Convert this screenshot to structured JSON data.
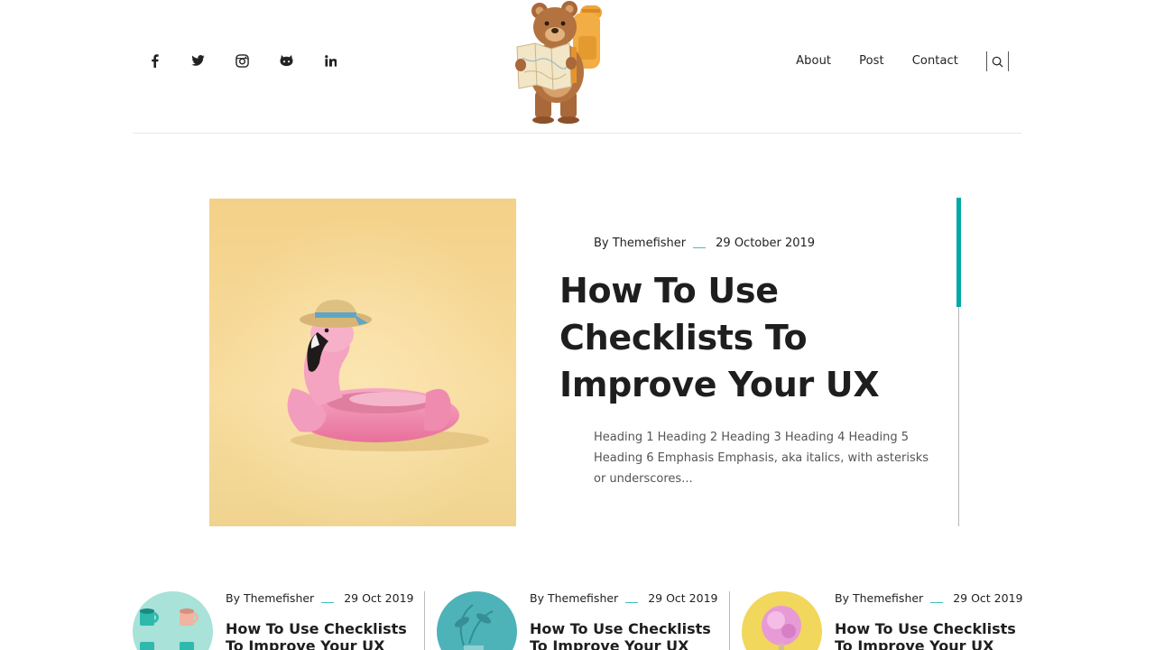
{
  "social": [
    {
      "icon": "facebook-icon"
    },
    {
      "icon": "twitter-icon"
    },
    {
      "icon": "instagram-icon"
    },
    {
      "icon": "github-icon"
    },
    {
      "icon": "linkedin-icon"
    }
  ],
  "nav": {
    "about": "About",
    "post": "Post",
    "contact": "Contact",
    "search_icon": "search-icon"
  },
  "featured": {
    "author": "By Themefisher",
    "date": "29 October 2019",
    "title": "How To Use Checklists To Improve Your UX",
    "excerpt": "Heading 1 Heading 2 Heading 3 Heading 4 Heading 5 Heading 6 Emphasis Emphasis, aka italics, with asterisks or underscores..."
  },
  "cards": [
    {
      "author": "By Themefisher",
      "date": "29 Oct 2019",
      "title": "How To Use Checklists To Improve Your UX"
    },
    {
      "author": "By Themefisher",
      "date": "29 Oct 2019",
      "title": "How To Use Checklists To Improve Your UX"
    },
    {
      "author": "By Themefisher",
      "date": "29 Oct 2019",
      "title": "How To Use Checklists To Improve Your UX"
    }
  ],
  "colors": {
    "accent": "#00a9a5",
    "meta_dash": "#3bc2bd",
    "text": "#1e1e1e",
    "muted": "#555555",
    "feature_bg": "#f3d48e"
  }
}
